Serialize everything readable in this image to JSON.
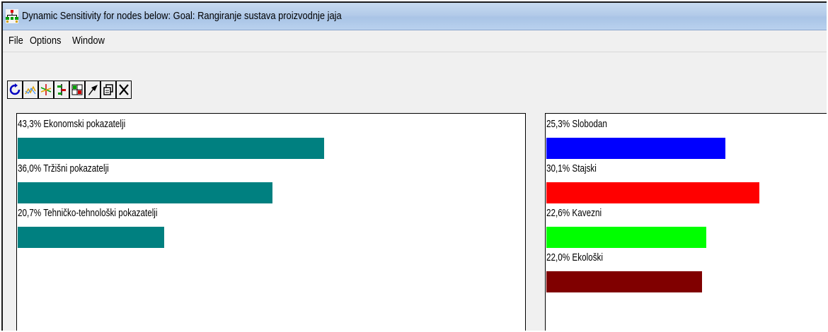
{
  "window": {
    "title": "Dynamic Sensitivity for nodes below: Goal: Rangiranje sustava proizvodnje jaja"
  },
  "menu": {
    "items": [
      {
        "label": "File"
      },
      {
        "label": "Options"
      },
      {
        "label": "Window"
      }
    ]
  },
  "toolbar": {
    "buttons": [
      {
        "icon": "refresh-icon"
      },
      {
        "icon": "performance-graph-icon"
      },
      {
        "icon": "gradient-graph-icon"
      },
      {
        "icon": "head-to-head-icon"
      },
      {
        "icon": "two-d-graph-icon"
      },
      {
        "icon": "pointer-icon"
      },
      {
        "icon": "copy-icon"
      },
      {
        "icon": "close-icon"
      }
    ]
  },
  "criteria_panel": {
    "items": [
      {
        "label": "43,3% Ekonomski pokazatelji",
        "value": 0.433,
        "color": "#008080"
      },
      {
        "label": "36,0% Tržišni pokazatelji",
        "value": 0.36,
        "color": "#008080"
      },
      {
        "label": "20,7% Tehničko-tehnološki pokazatelji",
        "value": 0.207,
        "color": "#008080"
      }
    ]
  },
  "alternatives_panel": {
    "items": [
      {
        "label": "25,3% Slobodan",
        "value": 0.253,
        "color": "#0000ff"
      },
      {
        "label": "30,1% Stajski",
        "value": 0.301,
        "color": "#ff0000"
      },
      {
        "label": "22,6% Kavezni",
        "value": 0.226,
        "color": "#00ff00"
      },
      {
        "label": "22,0% Ekološki",
        "value": 0.22,
        "color": "#800000"
      }
    ]
  }
}
